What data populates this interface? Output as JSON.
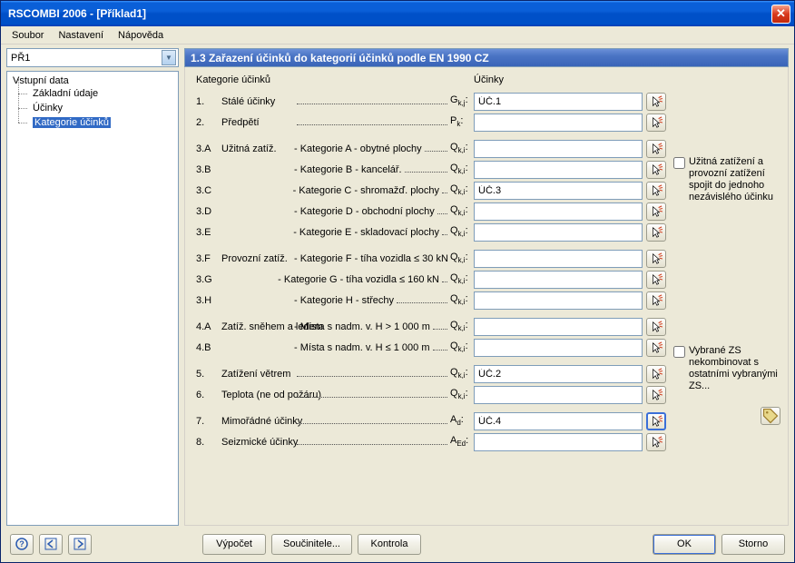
{
  "window": {
    "title": "RSCOMBI 2006 - [Příklad1]"
  },
  "menu": {
    "soubor": "Soubor",
    "nastaveni": "Nastavení",
    "napoveda": "Nápověda"
  },
  "combo": {
    "value": "PŘ1"
  },
  "tree": {
    "root": "Vstupní data",
    "items": [
      "Základní údaje",
      "Účinky",
      "Kategorie účinků"
    ]
  },
  "section_title": "1.3 Zařazení účinků do kategorií účinků podle EN 1990 CZ",
  "headers": {
    "kategorie": "Kategorie účinků",
    "ucinky": "Účinky"
  },
  "rows": [
    {
      "num": "1.",
      "main": "Stálé účinky",
      "sub": "",
      "sym": "G<sub>k,j</sub>:",
      "val": "ÚČ.1",
      "gap": false,
      "active": false
    },
    {
      "num": "2.",
      "main": "Předpětí",
      "sub": "",
      "sym": "P<sub>k</sub>:",
      "val": "",
      "gap": false,
      "active": false
    },
    {
      "num": "3.A",
      "main": "Užitná zatíž.",
      "sub": "- Kategorie A - obytné plochy",
      "sym": "Q<sub>k,i</sub>:",
      "val": "",
      "gap": true,
      "active": false
    },
    {
      "num": "3.B",
      "main": "",
      "sub": "- Kategorie B - kancelář.",
      "sym": "Q<sub>k,i</sub>:",
      "val": "",
      "gap": false,
      "active": false
    },
    {
      "num": "3.C",
      "main": "",
      "sub": "- Kategorie C - shromažď. plochy",
      "sym": "Q<sub>k,i</sub>:",
      "val": "ÚČ.3",
      "gap": false,
      "active": false
    },
    {
      "num": "3.D",
      "main": "",
      "sub": "- Kategorie D - obchodní plochy",
      "sym": "Q<sub>k,i</sub>:",
      "val": "",
      "gap": false,
      "active": false
    },
    {
      "num": "3.E",
      "main": "",
      "sub": "- Kategorie E - skladovací plochy",
      "sym": "Q<sub>k,i</sub>:",
      "val": "",
      "gap": false,
      "active": false
    },
    {
      "num": "3.F",
      "main": "Provozní zatíž.",
      "sub": "- Kategorie F - tíha vozidla ≤ 30 kN",
      "sym": "Q<sub>k,i</sub>:",
      "val": "",
      "gap": true,
      "active": false
    },
    {
      "num": "3.G",
      "main": "",
      "sub": "- Kategorie G - tíha vozidla ≤ 160 kN",
      "sym": "Q<sub>k,i</sub>:",
      "val": "",
      "gap": false,
      "active": false
    },
    {
      "num": "3.H",
      "main": "",
      "sub": "- Kategorie H - střechy",
      "sym": "Q<sub>k,i</sub>:",
      "val": "",
      "gap": false,
      "active": false
    },
    {
      "num": "4.A",
      "main": "Zatíž. sněhem a ledem",
      "sub": "- Místa s nadm. v. H > 1 000 m",
      "sym": "Q<sub>k,i</sub>:",
      "val": "",
      "gap": true,
      "active": false
    },
    {
      "num": "4.B",
      "main": "",
      "sub": "- Místa s nadm. v. H ≤ 1 000 m",
      "sym": "Q<sub>k,i</sub>:",
      "val": "",
      "gap": false,
      "active": false
    },
    {
      "num": "5.",
      "main": "Zatížení větrem",
      "sub": "",
      "sym": "Q<sub>k,i</sub>:",
      "val": "ÚČ.2",
      "gap": true,
      "active": false
    },
    {
      "num": "6.",
      "main": "Teplota (ne od požáru)",
      "sub": "",
      "sym": "Q<sub>k,i</sub>:",
      "val": "",
      "gap": false,
      "active": false
    },
    {
      "num": "7.",
      "main": "Mimořádné účinky",
      "sub": "",
      "sym": "A<sub>d</sub>:",
      "val": "ÚČ.4",
      "gap": true,
      "active": true
    },
    {
      "num": "8.",
      "main": "Seizmické účinky",
      "sub": "",
      "sym": "A<sub>Ed</sub>:",
      "val": "",
      "gap": false,
      "active": false
    }
  ],
  "side": {
    "opt1": "Užitná zatížení a provozní zatížení spojit do jednoho nezávislého účinku",
    "opt2": "Vybrané ZS nekombinovat s ostatními vybranými ZS..."
  },
  "footer": {
    "vypocet": "Výpočet",
    "soucinitele": "Součinitele...",
    "kontrola": "Kontrola",
    "ok": "OK",
    "storno": "Storno"
  }
}
